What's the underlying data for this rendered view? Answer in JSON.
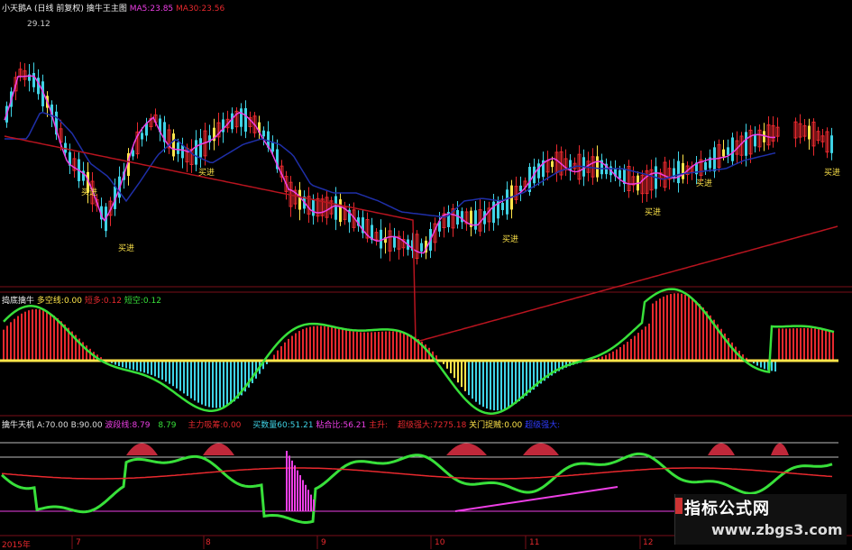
{
  "header": {
    "title": "小天鹅A",
    "period": "(日线 前复权)",
    "main_indicator": "擒牛王主图",
    "ma5_label": "MA5:",
    "ma5_value": "23.85",
    "ma30_label": "MA30:",
    "ma30_value": "23.56",
    "high_price": "29.12",
    "signal_label": "买进"
  },
  "panel2": {
    "title": "捣底擒牛",
    "duokong_label": "多空线:",
    "duokong_value": "0.00",
    "zhangduo_label": "短多:",
    "zhangduo_value": "0.12",
    "zhangkong_label": "短空:",
    "zhangkong_value": "0.12"
  },
  "panel3": {
    "title": "擒牛天机",
    "a_label": "A:",
    "a_value": "70.00",
    "b_label": "B:",
    "b_value": "90.00",
    "c_label": "波段线:",
    "c_value": "8.79",
    "d_value": "8.79",
    "e_label": "主力吸筹:",
    "e_value": "0.00",
    "f_label": "买数量60:",
    "f_value": "51.21",
    "g_label": "粘合比:",
    "g_value": "56.21",
    "h_label": "主升:",
    "h_value": "",
    "i_label": "超级强大:",
    "i_value": "7275.18",
    "j_label": "关门捉贼:",
    "j_value": "0.00",
    "k_label": "超级强大:"
  },
  "xaxis": {
    "labels": [
      "2015年",
      "7",
      "8",
      "9",
      "10",
      "11",
      "12"
    ]
  },
  "watermark": {
    "line1": "指标公式网",
    "line2": "www.zbgs3.com"
  },
  "colors": {
    "up": "#e8292e",
    "down": "#3fd3e6",
    "yellow": "#ffe54a",
    "green": "#38e03a",
    "magenta": "#ee3fe6",
    "ma_red": "#b8141f",
    "ma_blue": "#1f2fa8",
    "grid": "#7a0e18"
  }
}
